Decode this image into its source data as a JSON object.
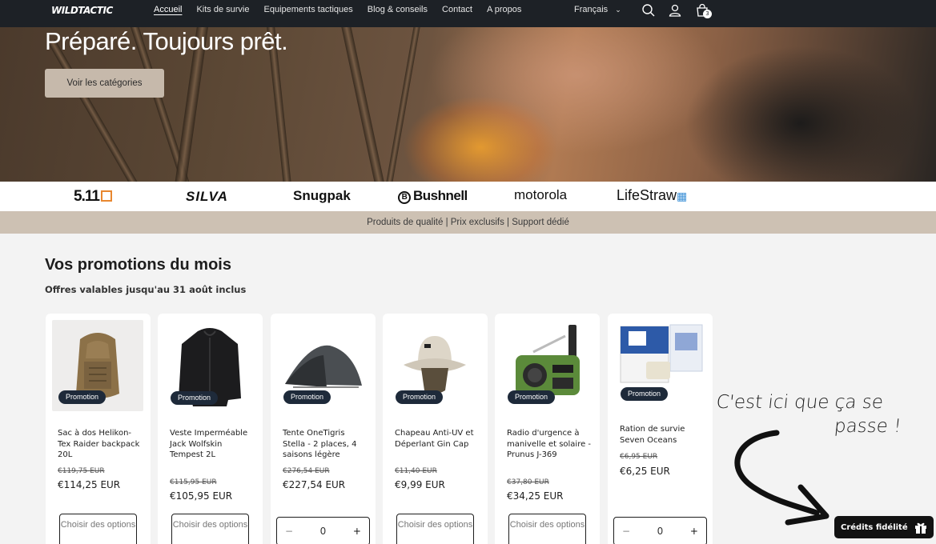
{
  "header": {
    "logo": "WILDTACTIC",
    "nav": [
      "Accueil",
      "Kits de survie",
      "Equipements tactiques",
      "Blog & conseils",
      "Contact",
      "A propos"
    ],
    "language": "Français",
    "cart_count": "3"
  },
  "hero": {
    "title": "Préparé. Toujours prêt.",
    "button": "Voir les catégories"
  },
  "brands": [
    "5.11",
    "SILVA",
    "Snugpak",
    "Bushnell",
    "motorola",
    "LifeStraw"
  ],
  "strip": "Produits de qualité | Prix exclusifs | Support dédié",
  "promotions": {
    "title": "Vos promotions du mois",
    "subtitle": "Offres valables jusqu'au 31 août inclus",
    "badge": "Promotion",
    "products": [
      {
        "name": "Sac à dos Helikon-Tex Raider backpack 20L",
        "old": "€119,75 EUR",
        "new": "€114,25 EUR",
        "action": "Choisir des options"
      },
      {
        "name": "Veste Imperméable Jack Wolfskin Tempest 2L",
        "old": "€115,95 EUR",
        "new": "€105,95 EUR",
        "action": "Choisir des options"
      },
      {
        "name": "Tente OneTigris Stella - 2 places, 4 saisons légère",
        "old": "€276,54 EUR",
        "new": "€227,54 EUR",
        "qty": "0"
      },
      {
        "name": "Chapeau Anti-UV et Déperlant Gin Cap",
        "old": "€11,40 EUR",
        "new": "€9,99 EUR",
        "action": "Choisir des options"
      },
      {
        "name": "Radio d'urgence à manivelle et solaire - Prunus J-369",
        "old": "€37,80 EUR",
        "new": "€34,25 EUR",
        "action": "Choisir des options"
      },
      {
        "name": "Ration de survie Seven Oceans",
        "old": "€6,95 EUR",
        "new": "€6,25 EUR",
        "qty": "0"
      }
    ]
  },
  "annotation": {
    "line1": "C'est ici que ça se",
    "line2": "passe !"
  },
  "loyalty": "Crédits fidélité",
  "icons": [
    "search-icon",
    "account-icon",
    "cart-icon",
    "chevron-down-icon",
    "gift-icon",
    "arrow-icon"
  ]
}
